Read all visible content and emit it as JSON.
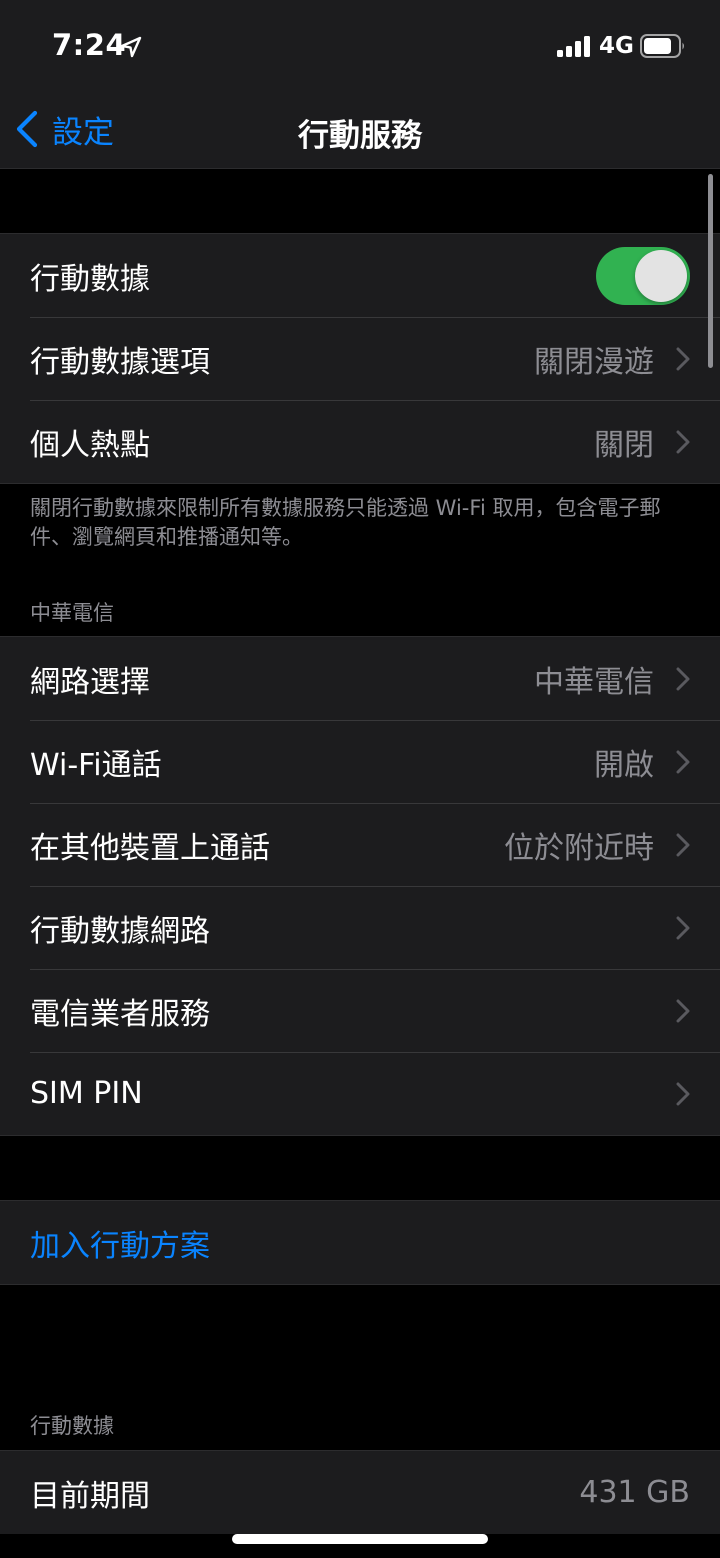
{
  "status_bar": {
    "time": "7:24",
    "network": "4G"
  },
  "nav": {
    "back_label": "設定",
    "title": "行動服務"
  },
  "group_cellular": {
    "rows": [
      {
        "label": "行動數據",
        "toggle_on": true
      },
      {
        "label": "行動數據選項",
        "value": "關閉漫遊"
      },
      {
        "label": "個人熱點",
        "value": "關閉"
      }
    ],
    "footer": "關閉行動數據來限制所有數據服務只能透過 Wi-Fi 取用，包含電子郵件、瀏覽網頁和推播通知等。"
  },
  "group_carrier": {
    "header": "中華電信",
    "rows": [
      {
        "label": "網路選擇",
        "value": "中華電信"
      },
      {
        "label": "Wi-Fi通話",
        "value": "開啟"
      },
      {
        "label": "在其他裝置上通話",
        "value": "位於附近時"
      },
      {
        "label": "行動數據網路",
        "value": ""
      },
      {
        "label": "電信業者服務",
        "value": ""
      },
      {
        "label": "SIM PIN",
        "value": ""
      }
    ]
  },
  "group_plan": {
    "link_label": "加入行動方案"
  },
  "group_usage": {
    "header": "行動數據",
    "rows": [
      {
        "label": "目前期間",
        "value": "431 GB"
      }
    ]
  },
  "colors": {
    "accent": "#0a84ff",
    "toggle_on": "#34c759",
    "background": "#000000",
    "cell": "#1c1c1e",
    "secondary_text": "#8d8d93"
  },
  "icons": {
    "location": "location-arrow-icon",
    "signal": "cellular-signal-icon",
    "battery": "battery-icon",
    "back": "chevron-left-icon",
    "disclosure": "chevron-right-icon"
  }
}
